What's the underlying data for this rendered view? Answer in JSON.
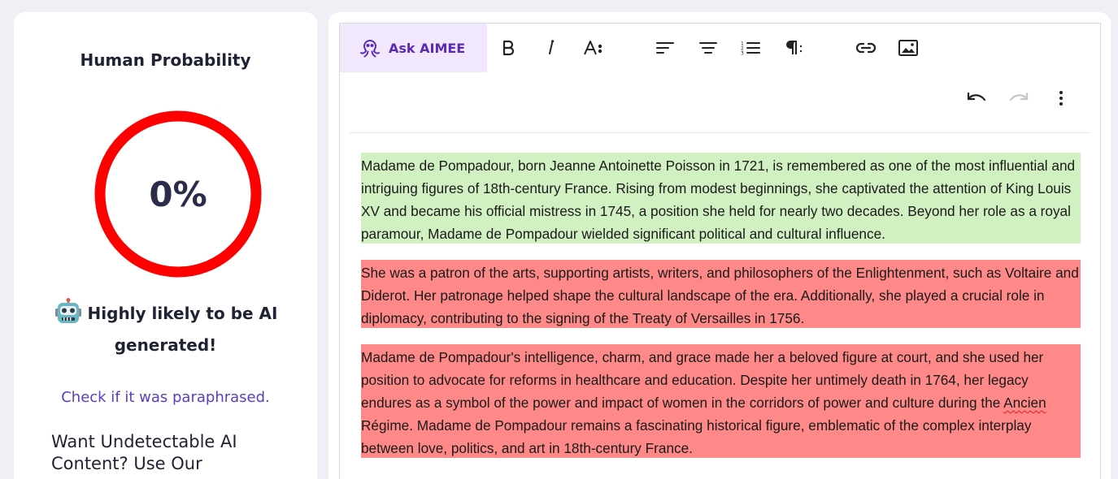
{
  "left_panel": {
    "title": "Human Probability",
    "score_label": "0%",
    "human_probability_percent": 0,
    "gauge_color": "#ff0000",
    "verdict_line1": "Highly likely to be AI",
    "verdict_line2": "generated!",
    "verdict_icon": "robot-icon",
    "paraphrase_link": "Check if it was paraphrased.",
    "promo_line1": "Want Undetectable AI",
    "promo_line2": "Content? Use Our"
  },
  "toolbar": {
    "ask_label": "Ask AIMEE",
    "ask_icon": "octopus-icon",
    "buttons": [
      "bold-icon",
      "italic-icon",
      "font-size-icon",
      "align-left-icon",
      "align-center-icon",
      "numbered-list-icon",
      "paragraph-icon",
      "link-icon",
      "image-icon"
    ],
    "secondary": [
      "undo-icon",
      "redo-icon",
      "more-vertical-icon"
    ],
    "colors": {
      "accent": "#5b2bb5",
      "ask_bg": "#f1e8fd"
    }
  },
  "document": {
    "paragraphs": [
      {
        "status": "human",
        "highlight": "#d2f1c2",
        "text": "Madame de Pompadour, born Jeanne Antoinette Poisson in 1721, is remembered as one of the most influential and intriguing figures of 18th-century France. Rising from modest beginnings, she captivated the attention of King Louis XV and became his official mistress in 1745, a position she held for nearly two decades. Beyond her role as a royal paramour, Madame de Pompadour wielded significant political and cultural influence."
      },
      {
        "status": "ai",
        "highlight": "#ff8989",
        "text": "She was a patron of the arts, supporting artists, writers, and philosophers of the Enlightenment, such as Voltaire and Diderot. Her patronage helped shape the cultural landscape of the era. Additionally, she played a crucial role in diplomacy, contributing to the signing of the Treaty of Versailles in 1756."
      },
      {
        "status": "ai",
        "highlight": "#ff8989",
        "text_before": "Madame de Pompadour's intelligence, charm, and grace made her a beloved figure at court, and she used her position to advocate for reforms in healthcare and education. Despite her untimely death in 1764, her legacy endures as a symbol of the power and impact of women in the corridors of power and culture during the ",
        "misspelled": "Ancien",
        "text_after": " Régime. Madame de Pompadour remains a fascinating historical figure, emblematic of the complex interplay between love, politics, and art in 18th-century France."
      }
    ]
  }
}
